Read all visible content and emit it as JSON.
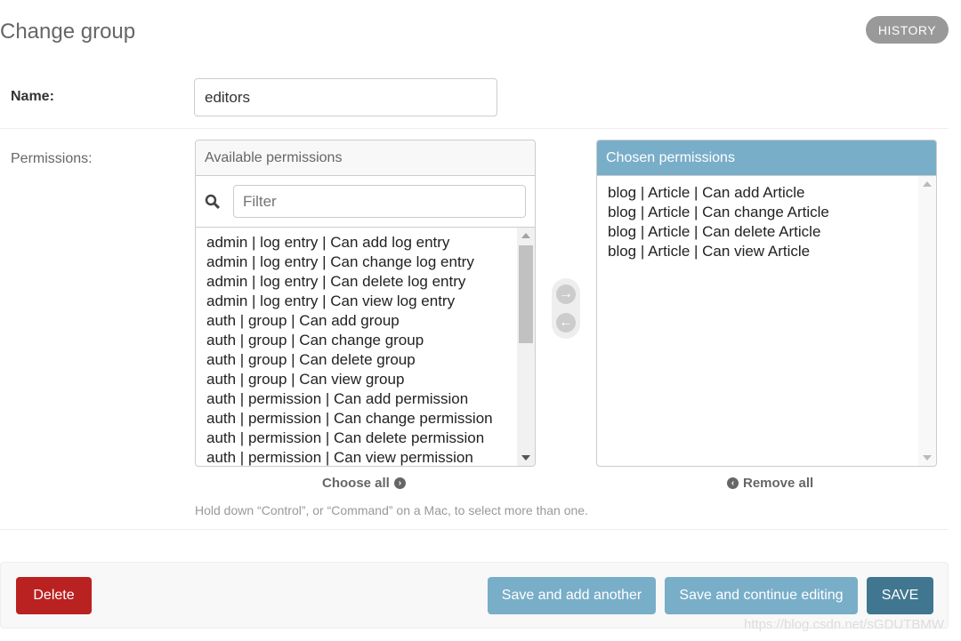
{
  "page": {
    "title": "Change group",
    "history": "HISTORY"
  },
  "form": {
    "name_label": "Name:",
    "name_value": "editors",
    "permissions_label": "Permissions:"
  },
  "available": {
    "title": "Available permissions",
    "filter_placeholder": "Filter",
    "items": [
      "admin | log entry | Can add log entry",
      "admin | log entry | Can change log entry",
      "admin | log entry | Can delete log entry",
      "admin | log entry | Can view log entry",
      "auth | group | Can add group",
      "auth | group | Can change group",
      "auth | group | Can delete group",
      "auth | group | Can view group",
      "auth | permission | Can add permission",
      "auth | permission | Can change permission",
      "auth | permission | Can delete permission",
      "auth | permission | Can view permission"
    ],
    "choose_all": "Choose all"
  },
  "chosen": {
    "title": "Chosen permissions",
    "items": [
      "blog | Article | Can add Article",
      "blog | Article | Can change Article",
      "blog | Article | Can delete Article",
      "blog | Article | Can view Article"
    ],
    "remove_all": "Remove all"
  },
  "help_text": "Hold down “Control”, or “Command” on a Mac, to select more than one.",
  "footer": {
    "delete": "Delete",
    "save_add": "Save and add another",
    "save_continue": "Save and continue editing",
    "save": "SAVE"
  },
  "watermark": "https://blog.csdn.net/sGDUTBMW",
  "colors": {
    "header": "#79aec8",
    "save": "#417690",
    "delete": "#ba2121"
  }
}
